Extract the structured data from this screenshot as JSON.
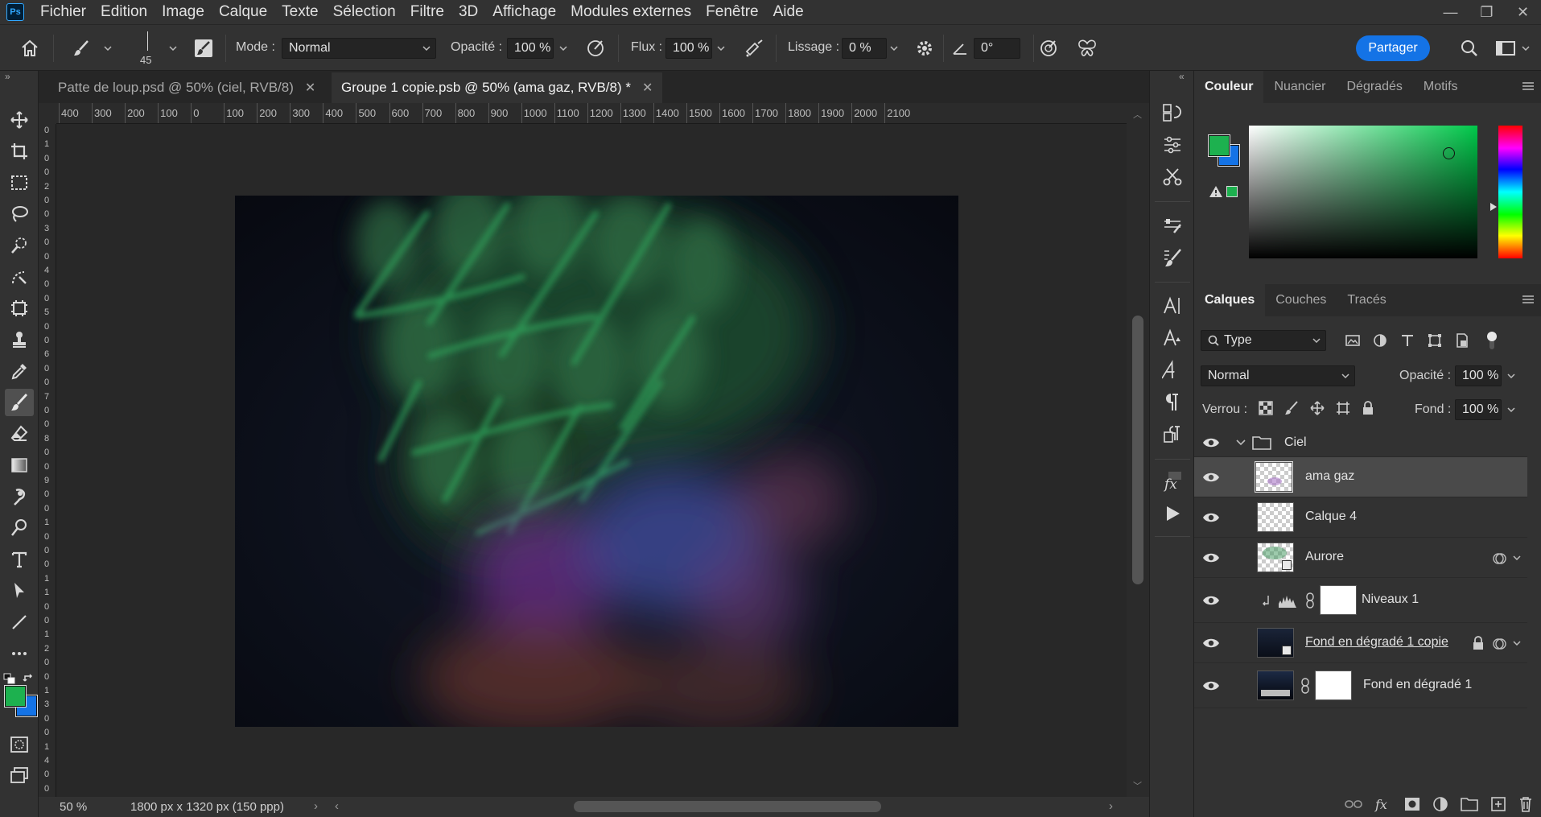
{
  "app": {
    "logo": "Ps"
  },
  "menu": [
    "Fichier",
    "Edition",
    "Image",
    "Calque",
    "Texte",
    "Sélection",
    "Filtre",
    "3D",
    "Affichage",
    "Modules externes",
    "Fenêtre",
    "Aide"
  ],
  "window_controls": {
    "minimize": "—",
    "restore": "❐",
    "close": "✕"
  },
  "options": {
    "brush_size": "45",
    "mode_label": "Mode :",
    "mode_value": "Normal",
    "opacity_label": "Opacité :",
    "opacity_value": "100 %",
    "flux_label": "Flux :",
    "flux_value": "100 %",
    "lissage_label": "Lissage :",
    "lissage_value": "0 %",
    "angle_value": "0°",
    "share_label": "Partager"
  },
  "tabs": [
    {
      "label": "Patte de loup.psd @ 50% (ciel, RVB/8)",
      "active": false
    },
    {
      "label": "Groupe 1 copie.psb @ 50% (ama gaz, RVB/8) *",
      "active": true
    }
  ],
  "rulers": {
    "horizontal": [
      "400",
      "300",
      "200",
      "100",
      "0",
      "100",
      "200",
      "300",
      "400",
      "500",
      "600",
      "700",
      "800",
      "900",
      "1000",
      "1100",
      "1200",
      "1300",
      "1400",
      "1500",
      "1600",
      "1700",
      "1800",
      "1900",
      "2000",
      "2100"
    ],
    "vertical": [
      "0",
      "1",
      "0",
      "0",
      "2",
      "0",
      "0",
      "3",
      "0",
      "0",
      "4",
      "0",
      "0",
      "5",
      "0",
      "0",
      "6",
      "0",
      "0",
      "7",
      "0",
      "0",
      "8",
      "0",
      "0",
      "9",
      "0",
      "0",
      "1",
      "0",
      "0",
      "0",
      "1",
      "1",
      "0",
      "0",
      "1",
      "2",
      "0",
      "0",
      "1",
      "3",
      "0",
      "0",
      "1",
      "4",
      "0",
      "0"
    ]
  },
  "status": {
    "zoom": "50 %",
    "doc_info": "1800 px x 1320 px (150 ppp)"
  },
  "colors": {
    "foreground": "#1db14f",
    "background": "#1473e6",
    "accent": "#1473e6",
    "gamut_swatch": "#1db14f"
  },
  "color_panel": {
    "tabs": [
      "Couleur",
      "Nuancier",
      "Dégradés",
      "Motifs"
    ],
    "active_tab": "Couleur"
  },
  "layers_panel": {
    "tabs": [
      "Calques",
      "Couches",
      "Tracés"
    ],
    "active_tab": "Calques",
    "filter_label": "Type",
    "blend_mode": "Normal",
    "opacity_label": "Opacité :",
    "opacity_value": "100 %",
    "lock_label": "Verrou :",
    "fill_label": "Fond :",
    "fill_value": "100 %",
    "layers": [
      {
        "name": "Ciel",
        "kind": "group",
        "visible": true
      },
      {
        "name": "ama gaz",
        "kind": "pixel",
        "visible": true,
        "selected": true
      },
      {
        "name": "Calque 4",
        "kind": "pixel",
        "visible": true
      },
      {
        "name": "Aurore",
        "kind": "smart",
        "visible": true
      },
      {
        "name": "Niveaux 1",
        "kind": "adjustment",
        "visible": true,
        "clipped": true
      },
      {
        "name": "Fond en dégradé 1 copie",
        "kind": "smart",
        "visible": true,
        "locked": true
      },
      {
        "name": "Fond en dégradé 1",
        "kind": "gradient-fill",
        "visible": true
      }
    ]
  }
}
